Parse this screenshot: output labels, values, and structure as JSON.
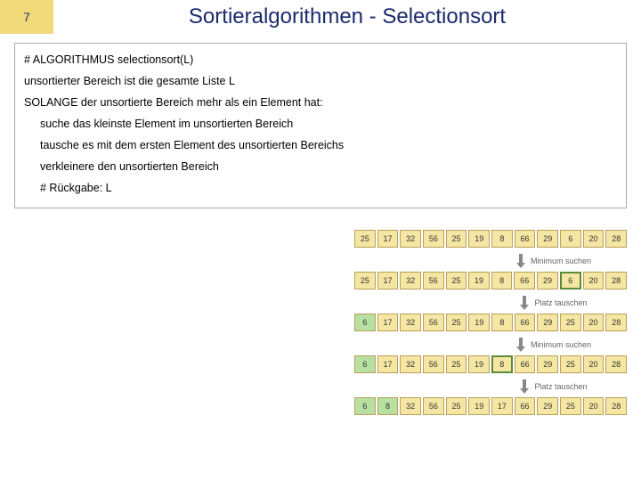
{
  "slide_number": "7",
  "title": "Sortieralgorithmen - Selectionsort",
  "algorithm": {
    "l0": "# ALGORITHMUS selectionsort(L)",
    "l1": "unsortierter Bereich ist die gesamte Liste L",
    "l2": "SOLANGE der unsortierte Bereich mehr als ein Element hat:",
    "l3": "suche das kleinste Element im unsortierten Bereich",
    "l4": "tausche es mit dem ersten Element des unsortierten Bereichs",
    "l5": "verkleinere den unsortierten Bereich",
    "l6": "# Rückgabe: L"
  },
  "diagram": {
    "row1": [
      "25",
      "17",
      "32",
      "56",
      "25",
      "19",
      "8",
      "66",
      "29",
      "6",
      "20",
      "28"
    ],
    "label1": "Minimum suchen",
    "row2": [
      "25",
      "17",
      "32",
      "56",
      "25",
      "19",
      "8",
      "66",
      "29",
      "6",
      "20",
      "28"
    ],
    "label2": "Platz tauschen",
    "row3": [
      "6",
      "17",
      "32",
      "56",
      "25",
      "19",
      "8",
      "66",
      "29",
      "25",
      "20",
      "28"
    ],
    "label3": "Minimum suchen",
    "row4": [
      "6",
      "17",
      "32",
      "56",
      "25",
      "19",
      "8",
      "66",
      "29",
      "25",
      "20",
      "28"
    ],
    "label4": "Platz tauschen",
    "row5": [
      "6",
      "8",
      "32",
      "56",
      "25",
      "19",
      "17",
      "66",
      "29",
      "25",
      "20",
      "28"
    ]
  }
}
